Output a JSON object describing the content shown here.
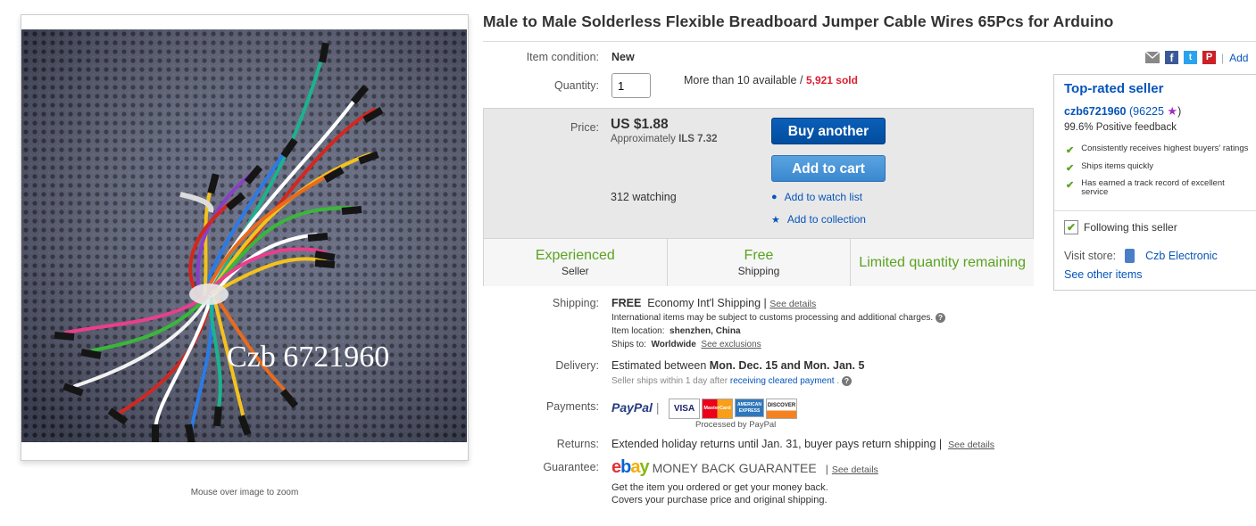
{
  "image": {
    "watermark": "Czb 6721960",
    "zoom_hint": "Mouse over image to zoom"
  },
  "item": {
    "title": "Male to Male Solderless Flexible Breadboard Jumper Cable Wires 65Pcs for Arduino",
    "condition_label": "Item condition:",
    "condition_value": "New",
    "quantity_label": "Quantity:",
    "quantity_value": "1",
    "availability": "More than 10 available",
    "availability_sep": "/",
    "sold": "5,921 sold"
  },
  "price": {
    "label": "Price:",
    "value": "US $1.88",
    "approx_prefix": "Approximately",
    "approx_value": "ILS 7.32",
    "watching": "312 watching",
    "buy_label": "Buy another",
    "cart_label": "Add to cart",
    "watch_link": "Add to watch list",
    "collection_link": "Add to collection"
  },
  "badges": [
    {
      "big": "Experienced",
      "small": "Seller"
    },
    {
      "big": "Free",
      "small": "Shipping"
    },
    {
      "big": "Limited quantity remaining",
      "small": ""
    }
  ],
  "shipping": {
    "label": "Shipping:",
    "free": "FREE",
    "service": "Economy Int'l Shipping",
    "sep": "|",
    "see_details": "See details",
    "intl_note": "International items may be subject to customs processing and additional charges.",
    "location_label": "Item location:",
    "location_value": "shenzhen, China",
    "ships_to_label": "Ships to:",
    "ships_to_value": "Worldwide",
    "see_exclusions": "See exclusions"
  },
  "delivery": {
    "label": "Delivery:",
    "prefix": "Estimated between",
    "dates": "Mon. Dec. 15 and Mon. Jan. 5",
    "note_prefix": "Seller ships within 1 day after",
    "note_link": "receiving cleared payment",
    "note_suffix": "."
  },
  "payments": {
    "label": "Payments:",
    "paypal": "PayPal",
    "cards": [
      "VISA",
      "MasterCard",
      "AMERICAN EXPRESS",
      "DISCOVER"
    ],
    "processed": "Processed by PayPal"
  },
  "returns": {
    "label": "Returns:",
    "text": "Extended holiday returns until Jan. 31, buyer pays return shipping",
    "sep": "|",
    "see_details": "See details"
  },
  "guarantee": {
    "label": "Guarantee:",
    "logo": "ebay",
    "headline": "MONEY BACK GUARANTEE",
    "sep": "|",
    "see_details": "See details",
    "line1": "Get the item you ordered or get your money back.",
    "line2": "Covers your purchase price and original shipping."
  },
  "share": {
    "add_link": "Add",
    "sep": "|"
  },
  "seller": {
    "heading": "Top-rated seller",
    "name": "czb6721960",
    "score": "(96225",
    "score_close": ")",
    "feedback": "99.6% Positive feedback",
    "features": [
      "Consistently receives highest buyers' ratings",
      "Ships items quickly",
      "Has earned a track record of excellent service"
    ],
    "following": "Following this seller",
    "visit_store_label": "Visit store:",
    "store_name": "Czb Electronic",
    "see_other": "See other items"
  },
  "colors": {
    "link": "#0654ba",
    "sold_red": "#dd1e31",
    "badge_green": "#5ba321",
    "buy_button": "#0654ba",
    "cart_button": "#3b88d0",
    "paypal_dark": "#253b80",
    "paypal_light": "#179bd7"
  }
}
